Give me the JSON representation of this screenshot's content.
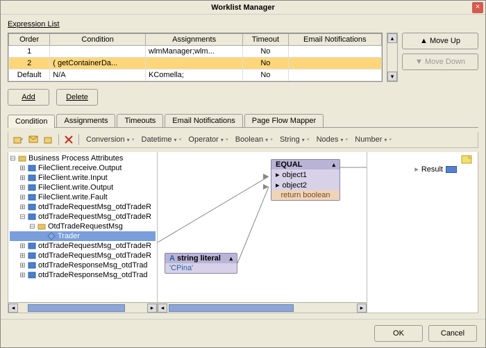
{
  "title": "Worklist Manager",
  "expression_list_label": "Expression List",
  "columns": [
    "Order",
    "Condition",
    "Assignments",
    "Timeout",
    "Email Notifications"
  ],
  "rows": [
    {
      "order": "1",
      "condition": "",
      "assignments": "wlmManager;wlm...",
      "timeout": "No",
      "email": "",
      "selected": false
    },
    {
      "order": "2",
      "condition": "( getContainerDa...",
      "assignments": "",
      "timeout": "No",
      "email": "",
      "selected": true
    },
    {
      "order": "Default",
      "condition": "N/A",
      "assignments": "KComella;",
      "timeout": "No",
      "email": "",
      "selected": false
    }
  ],
  "side": {
    "move_up": "Move Up",
    "move_down": "Move Down"
  },
  "actions": {
    "add": "Add",
    "delete": "Delete"
  },
  "tabs": [
    "Condition",
    "Assignments",
    "Timeouts",
    "Email Notifications",
    "Page Flow Mapper"
  ],
  "active_tab": 0,
  "toolbar_menus": [
    "Conversion",
    "Datetime",
    "Operator",
    "Boolean",
    "String",
    "Nodes",
    "Number"
  ],
  "tree": {
    "root": "Business Process Attributes",
    "items": [
      {
        "label": "FileClient.receive.Output",
        "indent": 1,
        "tw": "o"
      },
      {
        "label": "FileClient.write.Input",
        "indent": 1,
        "tw": "o"
      },
      {
        "label": "FileClient.write.Output",
        "indent": 1,
        "tw": "o"
      },
      {
        "label": "FileClient.write.Fault",
        "indent": 1,
        "tw": "o"
      },
      {
        "label": "otdTradeRequestMsg_otdTradeR",
        "indent": 1,
        "tw": "o"
      },
      {
        "label": "otdTradeRequestMsg_otdTradeR",
        "indent": 1,
        "tw": "p"
      },
      {
        "label": "OtdTradeRequestMsg",
        "indent": 2,
        "tw": "p",
        "icon": "folder"
      },
      {
        "label": "Trader",
        "indent": 3,
        "tw": "",
        "icon": "diamond",
        "selected": true
      },
      {
        "label": "otdTradeRequestMsg_otdTradeR",
        "indent": 1,
        "tw": "o"
      },
      {
        "label": "otdTradeRequestMsg_otdTradeR",
        "indent": 1,
        "tw": "o"
      },
      {
        "label": "otdTradeResponseMsg_otdTrad",
        "indent": 1,
        "tw": "o"
      },
      {
        "label": "otdTradeResponseMsg_otdTrad",
        "indent": 1,
        "tw": "o"
      }
    ]
  },
  "equal_node": {
    "title": "EQUAL",
    "ports": [
      "object1",
      "object2"
    ],
    "ret": "return boolean"
  },
  "literal_node": {
    "type_label": "string literal",
    "value": "'CPina'"
  },
  "result_label": "Result",
  "footer": {
    "ok": "OK",
    "cancel": "Cancel"
  }
}
